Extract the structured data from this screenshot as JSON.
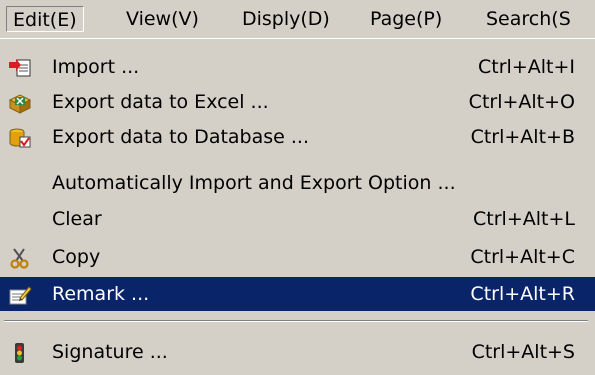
{
  "menubar": {
    "items": [
      {
        "label": "Edit(E)"
      },
      {
        "label": "View(V)"
      },
      {
        "label": "Disply(D)"
      },
      {
        "label": "Page(P)"
      },
      {
        "label": "Search(S"
      }
    ]
  },
  "dropdown": {
    "items": [
      {
        "label": "Import ...",
        "shortcut": "Ctrl+Alt+I",
        "icon": "import-icon"
      },
      {
        "label": "Export data to Excel ...",
        "shortcut": "Ctrl+Alt+O",
        "icon": "export-excel-icon"
      },
      {
        "label": "Export data to Database ...",
        "shortcut": "Ctrl+Alt+B",
        "icon": "export-database-icon"
      },
      {
        "label": "Automatically Import and Export Option ...",
        "shortcut": ""
      },
      {
        "label": "Clear",
        "shortcut": "Ctrl+Alt+L"
      },
      {
        "label": "Copy",
        "shortcut": "Ctrl+Alt+C",
        "icon": "scissors-icon"
      },
      {
        "label": "Remark ...",
        "shortcut": "Ctrl+Alt+R",
        "icon": "remark-icon",
        "selected": true
      },
      {
        "label": "Signature ...",
        "shortcut": "Ctrl+Alt+S",
        "icon": "signature-icon"
      }
    ]
  },
  "colors": {
    "menu_bg": "#d4d0c8",
    "highlight_bg": "#0a246a",
    "highlight_text": "#ffffff"
  }
}
